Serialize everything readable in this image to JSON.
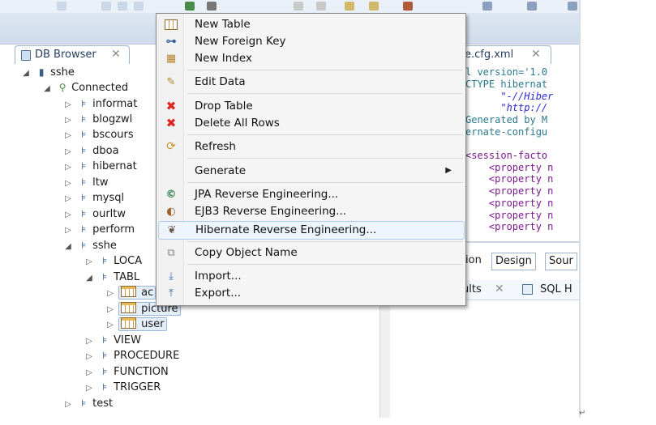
{
  "db_browser": {
    "tab_label": "DB Browser",
    "close": "✕",
    "tree": [
      {
        "label": "sshe",
        "kind": "root"
      },
      {
        "label": "Connected",
        "kind": "connection"
      },
      {
        "label": "informat",
        "kind": "schema"
      },
      {
        "label": "blogzwl",
        "kind": "schema"
      },
      {
        "label": "bscours",
        "kind": "schema"
      },
      {
        "label": "dboa",
        "kind": "schema"
      },
      {
        "label": "hibernat",
        "kind": "schema"
      },
      {
        "label": "ltw",
        "kind": "schema"
      },
      {
        "label": "mysql",
        "kind": "schema"
      },
      {
        "label": "ourltw",
        "kind": "schema"
      },
      {
        "label": "perform",
        "kind": "schema"
      },
      {
        "label": "sshe",
        "kind": "schema"
      },
      {
        "label": "LOCA",
        "kind": "folder"
      },
      {
        "label": "TABL",
        "kind": "folder"
      },
      {
        "label": "ac",
        "kind": "table"
      },
      {
        "label": "picture",
        "kind": "table"
      },
      {
        "label": "user",
        "kind": "table"
      },
      {
        "label": "VIEW",
        "kind": "folder"
      },
      {
        "label": "PROCEDURE",
        "kind": "folder"
      },
      {
        "label": "FUNCTION",
        "kind": "folder"
      },
      {
        "label": "TRIGGER",
        "kind": "folder"
      },
      {
        "label": "test",
        "kind": "schema"
      }
    ]
  },
  "editor": {
    "tab_label": "e.cfg.xml",
    "close": "✕",
    "lines": [
      "l version='1.0",
      "CTYPE hibernat",
      "      \"-//Hiber",
      "      \"http://",
      "Generated by M",
      "ernate-configu",
      "",
      "<session-facto",
      "    <property n",
      "    <property n",
      "    <property n",
      "    <property n",
      "    <property n",
      "    <property n"
    ],
    "bottom_tabs": [
      "ion",
      "Design",
      "Sour"
    ],
    "results_tabs": [
      "ults",
      "SQL H"
    ]
  },
  "context_menu": {
    "items": [
      {
        "label": "New Table",
        "icon": "table-icon"
      },
      {
        "label": "New Foreign Key",
        "icon": "foreign-key-icon"
      },
      {
        "label": "New Index",
        "icon": "index-icon"
      },
      {
        "label": "Edit Data",
        "icon": "edit-data-icon"
      },
      {
        "label": "Drop Table",
        "icon": "red-x-icon"
      },
      {
        "label": "Delete All Rows",
        "icon": "red-x-icon"
      },
      {
        "label": "Refresh",
        "icon": "refresh-icon"
      },
      {
        "label": "Generate",
        "icon": "",
        "submenu": true
      },
      {
        "label": "JPA Reverse Engineering...",
        "icon": "jpa-icon"
      },
      {
        "label": "EJB3 Reverse Engineering...",
        "icon": "ejb3-icon"
      },
      {
        "label": "Hibernate Reverse Engineering...",
        "icon": "hibernate-icon",
        "highlighted": true
      },
      {
        "label": "Copy Object Name",
        "icon": "copy-icon"
      },
      {
        "label": "Import...",
        "icon": "import-icon"
      },
      {
        "label": "Export...",
        "icon": "export-icon"
      }
    ]
  },
  "colors": {
    "menu_highlight": "#eef4fc",
    "selection": "#e4eef9",
    "accent_blue": "#3a5f88"
  }
}
